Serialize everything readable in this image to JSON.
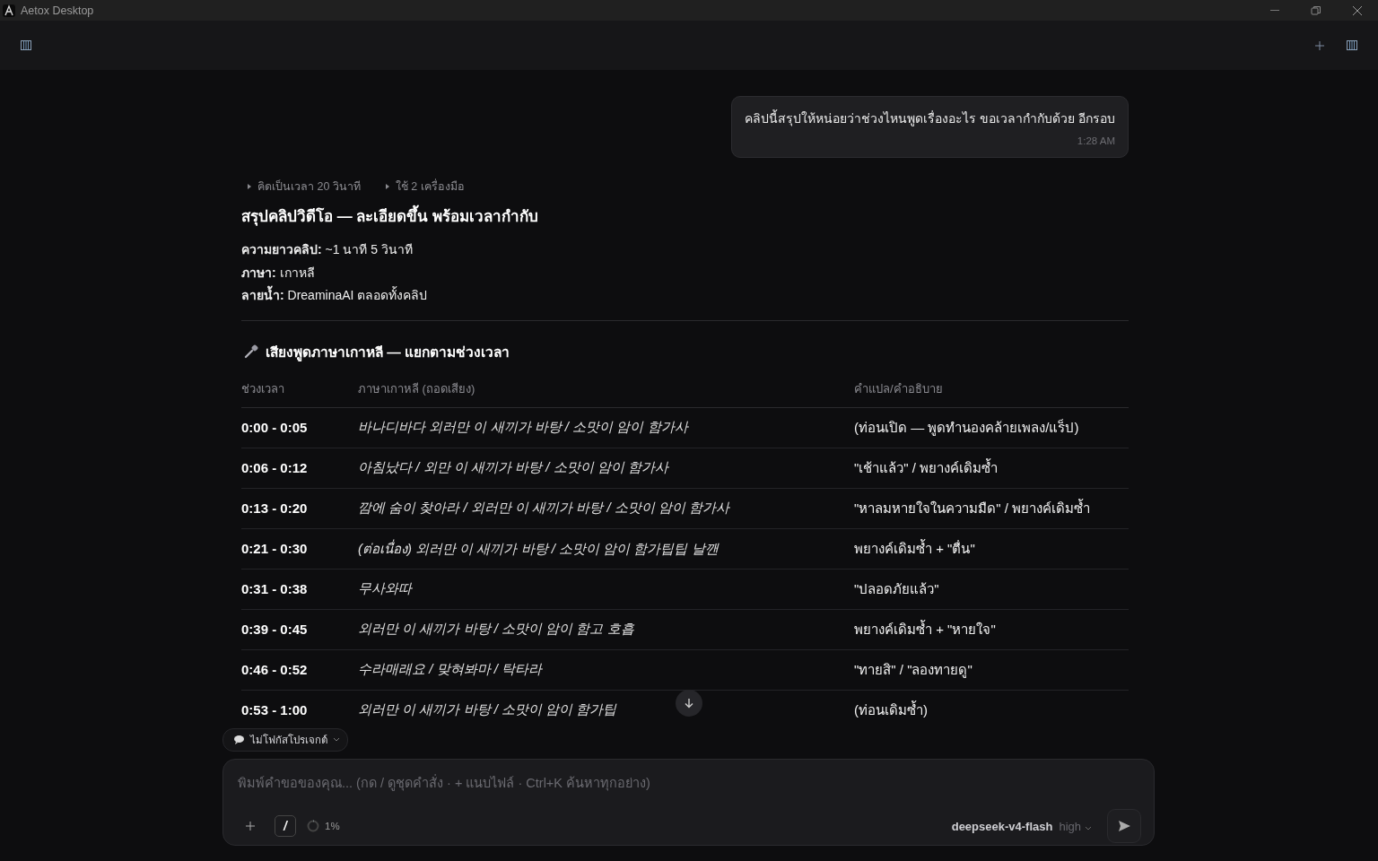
{
  "window": {
    "title": "Aetox Desktop"
  },
  "user_message": {
    "text": "คลิปนี้สรุปให้หน่อยว่าช่วงไหนพูดเรื่องอะไร ขอเวลากำกับด้วย อีกรอบ",
    "time": "1:28 AM"
  },
  "reply": {
    "steps": [
      "คิดเป็นเวลา 20 วินาที",
      "ใช้ 2 เครื่องมือ"
    ],
    "title": "สรุปคลิปวิดีโอ — ละเอียดขึ้น พร้อมเวลากำกับ",
    "facts": [
      "**ความยาวคลิป:** ~1 นาที 5 วินาที",
      "**ภาษา:** เกาหลี",
      "**ลายน้ำ:** DreaminaAI ตลอดทั้งคลิป"
    ],
    "section_title": "เสียงพูดภาษาเกาหลี — แยกตามช่วงเวลา",
    "table": {
      "columns": [
        "ช่วงเวลา",
        "ภาษาเกาหลี (ถอดเสียง)",
        "คำแปล/คำอธิบาย"
      ],
      "rows": [
        [
          "0:00 - 0:05",
          "바나디바다 외러만 이 새끼가 바탕 / 소맛이 암이 함가사",
          "(ท่อนเปิด — พูดทำนองคล้ายเพลง/แร็ป)"
        ],
        [
          "0:06 - 0:12",
          "아침났다 / 외만 이 새끼가 바탕 / 소맛이 암이 함가사",
          "\"เช้าแล้ว\" / พยางค์เดิมซ้ำ"
        ],
        [
          "0:13 - 0:20",
          "깜에 숨이 찾아라 / 외러만 이 새끼가 바탕 / 소맛이 암이 함가사",
          "\"หาลมหายใจในความมืด\" / พยางค์เดิมซ้ำ"
        ],
        [
          "0:21 - 0:30",
          "(ต่อเนื่อง) 외러만 이 새끼가 바탕 / 소맛이 암이 함가팁팁 날깬",
          "พยางค์เดิมซ้ำ + \"ตื่น\""
        ],
        [
          "0:31 - 0:38",
          "무사와따",
          "\"ปลอดภัยแล้ว\""
        ],
        [
          "0:39 - 0:45",
          "외러만 이 새끼가 바탕 / 소맛이 암이 함고 호흡",
          "พยางค์เดิมซ้ำ + \"หายใจ\""
        ],
        [
          "0:46 - 0:52",
          "수라매래요 / 맞혀봐마 / 탁타라",
          "\"ทายสิ\" / \"ลองทายดู\""
        ],
        [
          "0:53 - 1:00",
          "외러만 이 새끼가 바탕 / 소맛이 암이 함가팁",
          "(ท่อนเดิมซ้ำ)"
        ]
      ]
    }
  },
  "project_chip": {
    "label": "ไม่โฟกัสโปรเจกต์"
  },
  "composer": {
    "placeholder": "พิมพ์คำขอของคุณ... (กด / ดูชุดคำสั่ง · + แนบไฟล์ · Ctrl+K ค้นหาทุกอย่าง)",
    "slash": "/",
    "context": {
      "reading": "1%",
      "level": 0.01
    },
    "model": "deepseek-v4-flash",
    "effort": "high"
  }
}
